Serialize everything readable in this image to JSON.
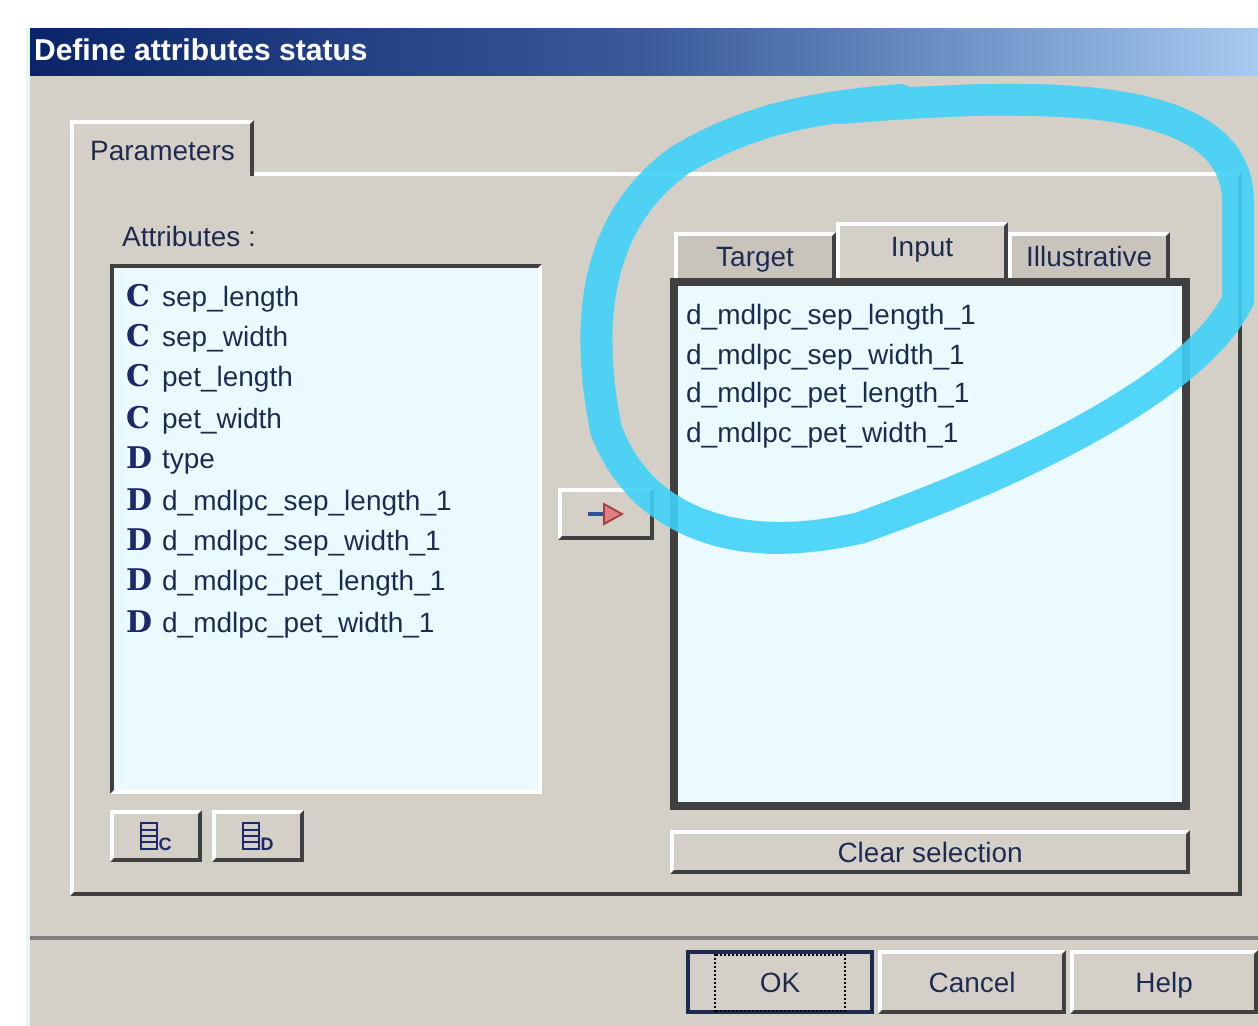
{
  "window": {
    "title": "Define attributes status"
  },
  "tabs": [
    {
      "label": "Parameters",
      "selected": true
    }
  ],
  "attributes": {
    "label": "Attributes :",
    "items": [
      {
        "glyph": "C",
        "name": "sep_length"
      },
      {
        "glyph": "C",
        "name": "sep_width"
      },
      {
        "glyph": "C",
        "name": "pet_length"
      },
      {
        "glyph": "C",
        "name": "pet_width"
      },
      {
        "glyph": "D",
        "name": "type"
      },
      {
        "glyph": "D",
        "name": "d_mdlpc_sep_length_1"
      },
      {
        "glyph": "D",
        "name": "d_mdlpc_sep_width_1"
      },
      {
        "glyph": "D",
        "name": "d_mdlpc_pet_length_1"
      },
      {
        "glyph": "D",
        "name": "d_mdlpc_pet_width_1"
      }
    ],
    "filter_buttons": [
      {
        "label": "C"
      },
      {
        "label": "D"
      }
    ]
  },
  "role_tabs": [
    {
      "label": "Target",
      "selected": false
    },
    {
      "label": "Input",
      "selected": true
    },
    {
      "label": "Illustrative",
      "selected": false
    }
  ],
  "selected_list": [
    "d_mdlpc_sep_length_1",
    "d_mdlpc_sep_width_1",
    "d_mdlpc_pet_length_1",
    "d_mdlpc_pet_width_1"
  ],
  "clear_button": "Clear selection",
  "buttons": [
    {
      "label": "OK",
      "focused": true
    },
    {
      "label": "Cancel",
      "focused": false
    },
    {
      "label": "Help",
      "focused": false
    }
  ]
}
